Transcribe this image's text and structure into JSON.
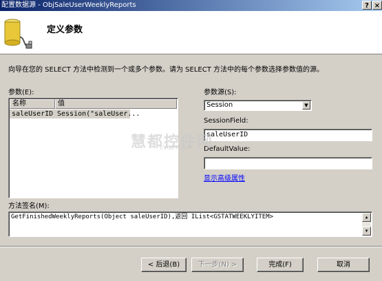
{
  "window": {
    "title": "配置数据源 - ObjSaleUserWeeklyReports",
    "help_label": "?",
    "close_label": "×"
  },
  "header": {
    "title": "定义参数",
    "icon": "database-plug-icon"
  },
  "description": "向导在您的 SELECT 方法中检测到一个或多个参数。请为 SELECT 方法中的每个参数选择参数值的源。",
  "parameters": {
    "label": "参数(E):",
    "columns": [
      "名称",
      "值"
    ],
    "rows": [
      {
        "name": "saleUserID",
        "value": "Session(\"saleUser..."
      }
    ]
  },
  "source": {
    "label": "参数源(S):",
    "selected": "Session",
    "session_field_label": "SessionField:",
    "session_field_value": "saleUserID",
    "default_value_label": "DefaultValue:",
    "default_value": "",
    "advanced_link": "显示高级属性"
  },
  "signature": {
    "label": "方法签名(M):",
    "text": "GetFinishedWeeklyReports(Object saleUserID),返回 IList<GSTATWEEKLYITEM>"
  },
  "buttons": {
    "back": "< 后退(B)",
    "next": "下一步(N) >",
    "finish": "完成(F)",
    "cancel": "取消"
  },
  "watermark": {
    "text": "慧都控件网",
    "subtext": "EVGET.COM"
  },
  "colors": {
    "titlebar_start": "#0a246a",
    "titlebar_end": "#a6caf0",
    "dialog_bg": "#d4d0c8",
    "selection": "#d4d0c8",
    "link": "#0000ff"
  }
}
